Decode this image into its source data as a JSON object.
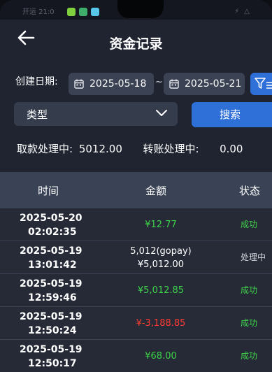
{
  "statusbar": {
    "carrier": "开运 21:0",
    "icons": "⚡ △",
    "app_dot_colors": [
      "#7fcf3f",
      "#3fae6c",
      "#56c7e8"
    ]
  },
  "header": {
    "back_icon": "arrow-left-icon",
    "title": "资金记录"
  },
  "filters": {
    "date_label": "创建日期:",
    "start_date": "2025-05-18",
    "separator": "~",
    "end_date": "2025-05-21",
    "type_label": "类型",
    "search_label": "搜索"
  },
  "summary": {
    "withdraw_label": "取款处理中:",
    "withdraw_value": "5012.00",
    "transfer_label": "转账处理中:",
    "transfer_value": "0.00"
  },
  "table": {
    "columns": [
      "时间",
      "金额",
      "状态"
    ],
    "rows": [
      {
        "date": "2025-05-20",
        "time": "02:02:35",
        "amount_line1": "¥12.77",
        "amount_line2": "",
        "status": "成功",
        "amount_color": "#3ed44a",
        "status_color": "#3ed44a"
      },
      {
        "date": "2025-05-19",
        "time": "13:01:42",
        "amount_line1": "5,012(gopay)",
        "amount_line2": "¥5,012.00",
        "status": "处理中",
        "amount_color": "#ffffff",
        "status_color": "#d6d8de"
      },
      {
        "date": "2025-05-19",
        "time": "12:59:46",
        "amount_line1": "¥5,012.85",
        "amount_line2": "",
        "status": "成功",
        "amount_color": "#3ed44a",
        "status_color": "#3ed44a"
      },
      {
        "date": "2025-05-19",
        "time": "12:50:24",
        "amount_line1": "¥-3,188.85",
        "amount_line2": "",
        "status": "成功",
        "amount_color": "#ff3b30",
        "status_color": "#3ed44a"
      },
      {
        "date": "2025-05-19",
        "time": "12:50:17",
        "amount_line1": "¥68.00",
        "amount_line2": "",
        "status": "成功",
        "amount_color": "#3ed44a",
        "status_color": "#3ed44a"
      }
    ]
  }
}
